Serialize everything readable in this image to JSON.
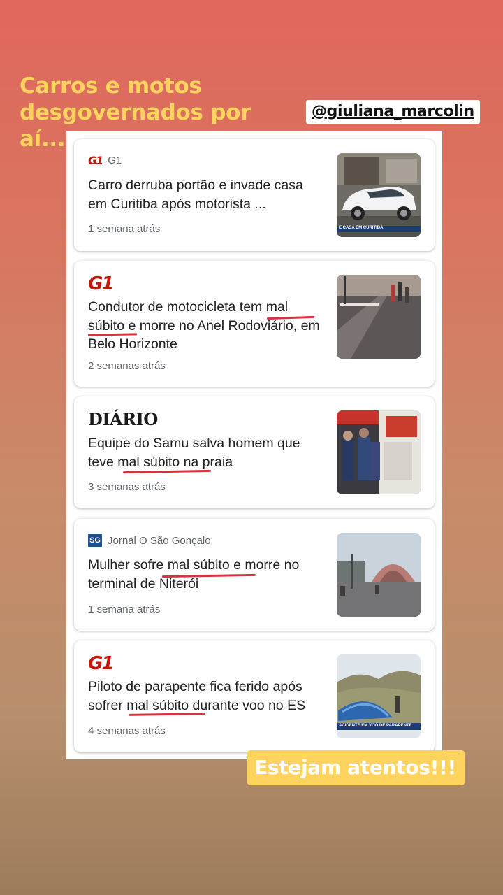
{
  "caption": "Carros e motos desgovernados por aí...",
  "mention": "@giuliana_marcolin",
  "cta": "Estejam atentos!!!",
  "news": [
    {
      "source_logo": "G1",
      "source_name": "G1",
      "headline": "Carro derruba portão e invade casa em Curitiba após motorista ...",
      "time": "1 semana atrás",
      "thumb_caption": "E CASA EM CURITIBA",
      "thumb_icon": "white-car-crash-photo"
    },
    {
      "source_logo": "G1",
      "source_name": "",
      "headline": "Condutor de motocicleta tem mal súbito e morre no Anel Rodoviário, em Belo Horizonte",
      "time": "2 semanas atrás",
      "thumb_icon": "motorcycle-accident-road-photo"
    },
    {
      "source_logo": "DIÁRIO",
      "source_name": "",
      "headline": "Equipe do Samu salva homem que teve mal súbito na praia",
      "time": "3 semanas atrás",
      "thumb_icon": "samu-ambulance-crew-photo"
    },
    {
      "source_logo": "SG",
      "source_name": "Jornal O São Gonçalo",
      "headline": "Mulher sofre mal súbito e morre no terminal de Niterói",
      "time": "1 semana atrás",
      "thumb_icon": "bus-terminal-photo"
    },
    {
      "source_logo": "G1",
      "source_name": "",
      "headline": "Piloto de parapente fica ferido após sofrer mal súbito durante voo no ES",
      "time": "4 semanas atrás",
      "thumb_caption": "ACIDENTE EM VOO DE PARAPENTE",
      "thumb_icon": "paraglider-crash-photo"
    }
  ],
  "colors": {
    "accent_yellow": "#ffd45e",
    "g1_red": "#c4170c",
    "underline_red": "#d6333f"
  }
}
